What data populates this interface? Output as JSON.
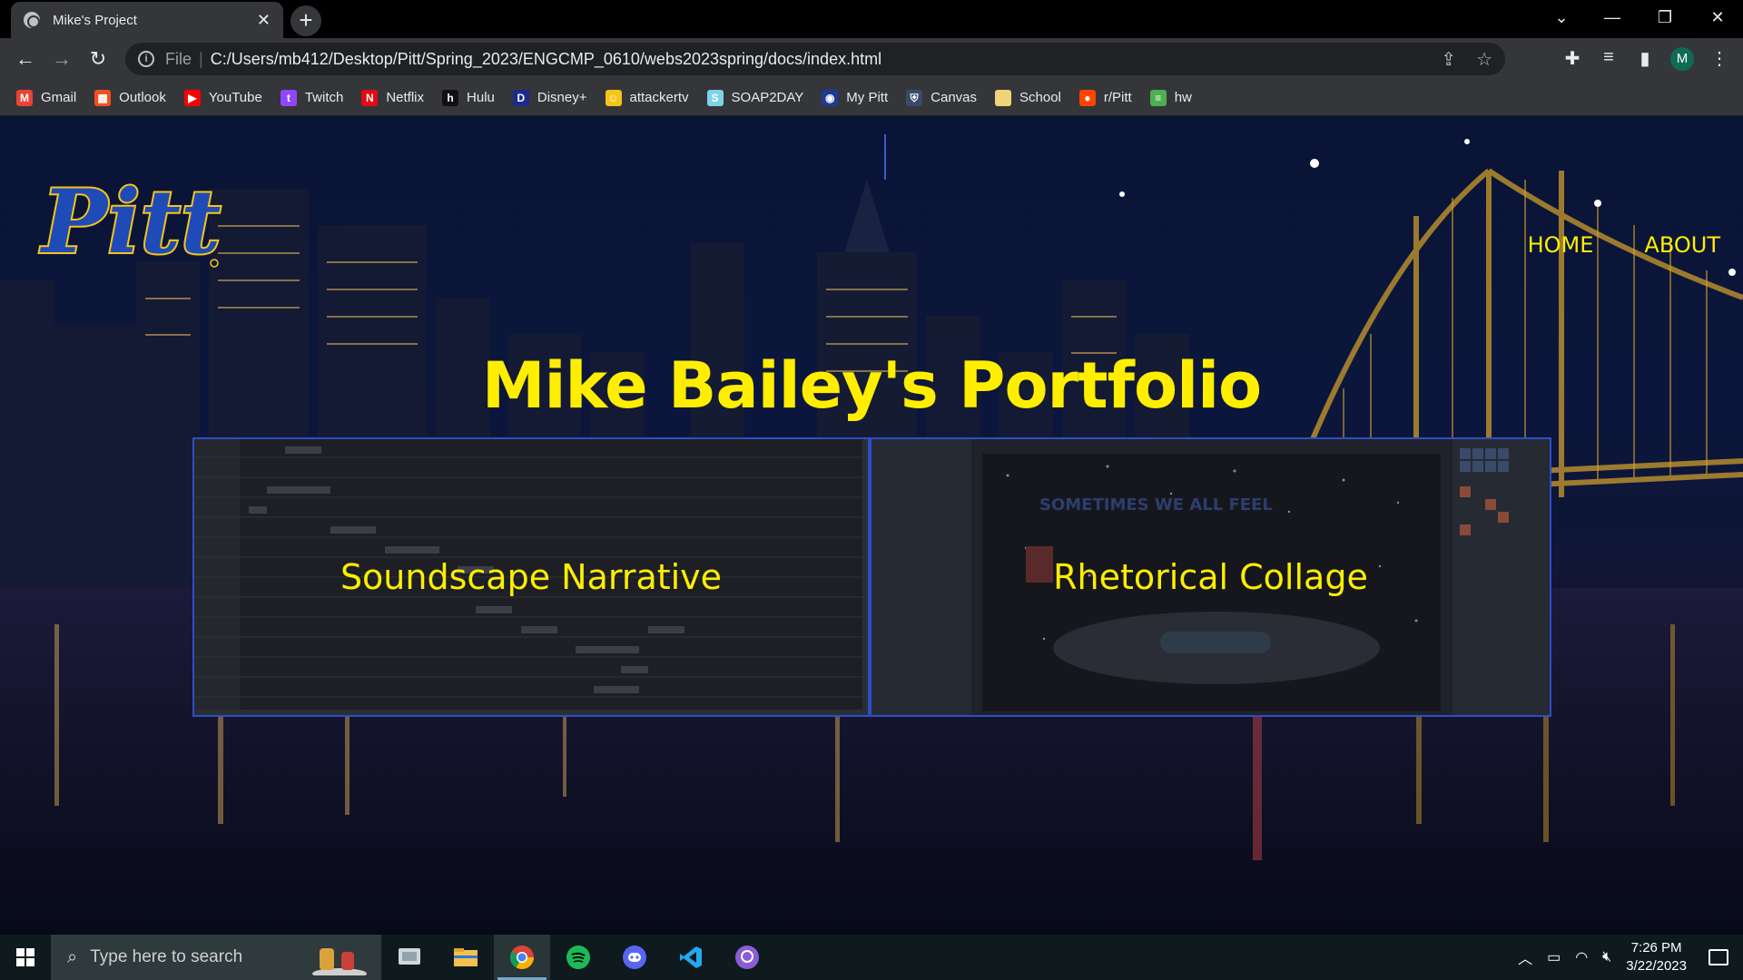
{
  "browser": {
    "tab_title": "Mike's Project",
    "tab_close": "✕",
    "new_tab": "+",
    "address_scheme": "File",
    "address_url": "C:/Users/mb412/Desktop/Pitt/Spring_2023/ENGCMP_0610/webs2023spring/docs/index.html",
    "profile_initial": "M",
    "bookmarks": [
      {
        "label": "Gmail",
        "icon": "gmail-icon",
        "color": "#ea4335",
        "glyph": "M"
      },
      {
        "label": "Outlook",
        "icon": "outlook-icon",
        "color": "#f25022",
        "glyph": "▦"
      },
      {
        "label": "YouTube",
        "icon": "youtube-icon",
        "color": "#ff0000",
        "glyph": "▶"
      },
      {
        "label": "Twitch",
        "icon": "twitch-icon",
        "color": "#9146ff",
        "glyph": "t"
      },
      {
        "label": "Netflix",
        "icon": "netflix-icon",
        "color": "#e50914",
        "glyph": "N"
      },
      {
        "label": "Hulu",
        "icon": "hulu-icon",
        "color": "#111111",
        "glyph": "h"
      },
      {
        "label": "Disney+",
        "icon": "disney-icon",
        "color": "#1a2b8c",
        "glyph": "D"
      },
      {
        "label": "attackertv",
        "icon": "attackertv-icon",
        "color": "#f5c518",
        "glyph": "☺"
      },
      {
        "label": "SOAP2DAY",
        "icon": "soap2day-icon",
        "color": "#7dd3e8",
        "glyph": "S"
      },
      {
        "label": "My Pitt",
        "icon": "mypitt-icon",
        "color": "#1f3a93",
        "glyph": "◉"
      },
      {
        "label": "Canvas",
        "icon": "canvas-icon",
        "color": "#3b4a6b",
        "glyph": "⛨"
      },
      {
        "label": "School",
        "icon": "folder-icon",
        "color": "#f2d37a",
        "glyph": ""
      },
      {
        "label": "r/Pitt",
        "icon": "reddit-icon",
        "color": "#ff4500",
        "glyph": "●"
      },
      {
        "label": "hw",
        "icon": "books-icon",
        "color": "#4caf50",
        "glyph": "≡"
      }
    ]
  },
  "page": {
    "nav": {
      "home": "HOME",
      "about": "ABOUT"
    },
    "title": "Mike Bailey's Portfolio",
    "cards": {
      "left_label": "Soundscape Narrative",
      "right_label": "Rhetorical Collage",
      "right_collage_text": "SOMETIMES WE ALL FEEL"
    },
    "logo_text": "Pitt"
  },
  "taskbar": {
    "search_placeholder": "Type here to search",
    "time": "7:26 PM",
    "date": "3/22/2023"
  },
  "colors": {
    "accent_yellow": "#ffee00",
    "card_border": "#2d4dc9",
    "pitt_blue": "#1f4bb8",
    "pitt_gold": "#f5c518"
  }
}
